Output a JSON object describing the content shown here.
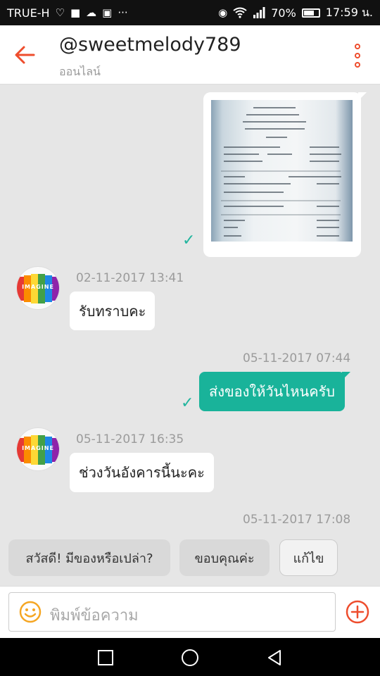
{
  "status_bar": {
    "carrier": "TRUE-H",
    "battery": "70%",
    "time": "17:59 น.",
    "icons": [
      "heartbeat-icon",
      "facebook-icon",
      "cloud-icon",
      "image-icon",
      "more-icon",
      "eye-icon",
      "wifi-icon",
      "signal-icon",
      "battery-icon"
    ]
  },
  "header": {
    "title": "@sweetmelody789",
    "subtitle": "ออนไลน์",
    "accent_color": "#ee4d2d"
  },
  "messages": {
    "m1": {
      "type": "image",
      "direction": "out",
      "status": "sent"
    },
    "m2": {
      "timestamp": "02-11-2017 13:41",
      "text": "รับทราบคะ",
      "direction": "in",
      "avatar_text": "IMAGINE"
    },
    "m3": {
      "timestamp": "05-11-2017 07:44",
      "text": "ส่งของให้วันไหนครับ",
      "direction": "out",
      "status": "sent"
    },
    "m4": {
      "timestamp": "05-11-2017 16:35",
      "text": "ช่วงวันอังคารนี้นะคะ",
      "direction": "in",
      "avatar_text": "IMAGINE"
    },
    "last_timestamp": "05-11-2017 17:08"
  },
  "quick_replies": {
    "q1": "สวัสดี! มีของหรือเปล่า?",
    "q2": "ขอบคุณค่ะ",
    "edit": "แก้ไข"
  },
  "input": {
    "placeholder": "พิมพ์ข้อความ"
  },
  "colors": {
    "out_bubble": "#19b39a",
    "check": "#22b59e",
    "accent": "#ee4d2d"
  }
}
